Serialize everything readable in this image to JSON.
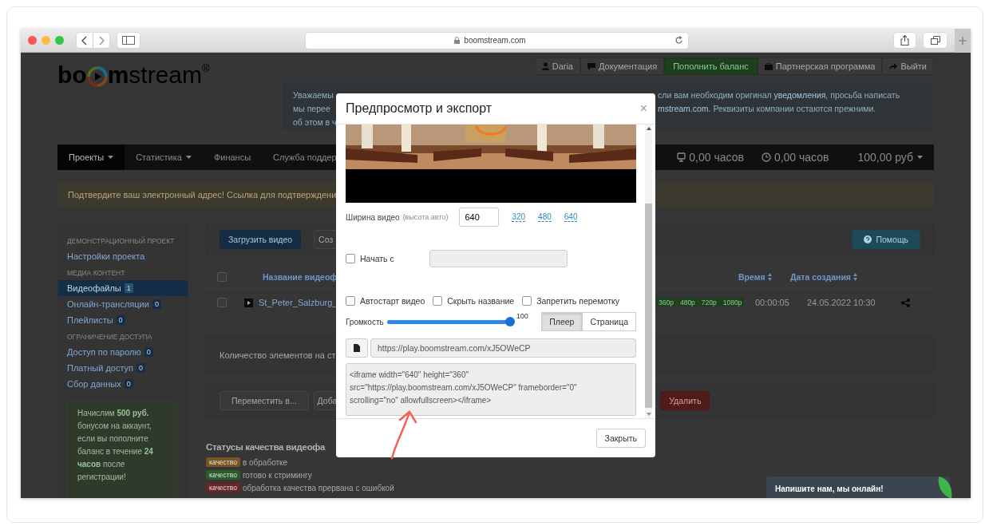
{
  "browser": {
    "address": "boomstream.com"
  },
  "logo": {
    "before": "bo",
    "after": "mstream",
    "mark": "®"
  },
  "top_nav": [
    {
      "label": "Daria",
      "kind": "default"
    },
    {
      "label": "Документация",
      "kind": "default"
    },
    {
      "label": "Пополнить баланс",
      "kind": "success"
    },
    {
      "label": "Партнерская программа",
      "kind": "default"
    },
    {
      "label": "Выйти",
      "kind": "default"
    }
  ],
  "notice": {
    "left_lines": [
      "Уважаемы",
      "мы перее",
      "об этом в ч"
    ],
    "right_lines": [
      "сли вам необходим оригинал **уведомления**, просьба написать",
      "**mstream.com**. Реквизиты компании остаются прежними."
    ]
  },
  "navbar": {
    "items": [
      {
        "label": "Проекты",
        "dropdown": true,
        "selected": true
      },
      {
        "label": "Статистика",
        "dropdown": true,
        "selected": false
      },
      {
        "label": "Финансы",
        "dropdown": false,
        "selected": false
      },
      {
        "label": "Служба поддер",
        "dropdown": false,
        "selected": false
      }
    ],
    "stats": [
      "0,00 часов",
      "0,00 часов"
    ],
    "balance": "100,00 руб"
  },
  "confirm_alert": "Подтвердите ваш электронный адрес! Ссылка для подтверждени",
  "sidebar": {
    "sections": [
      {
        "heading": "ДЕМОНСТРАЦИОННЫЙ ПРОЕКТ",
        "items": [
          {
            "label": "Настройки проекта",
            "selected": false
          }
        ]
      },
      {
        "heading": "МЕДИА КОНТЕНТ",
        "items": [
          {
            "label": "Видеофайлы",
            "count": "1",
            "selected": true
          },
          {
            "label": "Онлайн-трансляции",
            "count": "0",
            "selected": false
          },
          {
            "label": "Плейлисты",
            "count": "0",
            "selected": false
          }
        ]
      },
      {
        "heading": "ОГРАНИЧЕНИЕ ДОСТУПА",
        "items": [
          {
            "label": "Доступ по паролю",
            "count": "0",
            "selected": false
          },
          {
            "label": "Платный доступ",
            "count": "0",
            "selected": false
          },
          {
            "label": "Сбор данных",
            "count": "0",
            "selected": false
          }
        ]
      }
    ],
    "bonus": "Начислим **500 руб.** бонусом на аккаунт, если вы пополните баланс в течение **24 часов** после регистрации!"
  },
  "toolbar": {
    "upload": "Загрузить видео",
    "create": "Соз",
    "help": "Помощь"
  },
  "table": {
    "select_all_checked": false,
    "columns": [
      {
        "label": "Название видеоф"
      },
      {
        "label": "Время",
        "sortable": true
      },
      {
        "label": "Дата создания",
        "sortable": true
      }
    ],
    "rows": [
      {
        "checked": false,
        "name": "St_Peter_Salzburg_",
        "tags": [
          "360p",
          "480p",
          "720p",
          "1080p"
        ],
        "time": "00:00:05",
        "date": "24.05.2022 10:30"
      }
    ]
  },
  "page_size_label": "Количество элементов на ст",
  "bulk": {
    "move": "Переместить в...",
    "add": "Доба",
    "delete": "Удалить"
  },
  "statuses": {
    "title": "Статусы качества видеофа",
    "items": [
      {
        "tag": "качество",
        "color": "#7a5520",
        "text": "в обработке"
      },
      {
        "tag": "качество",
        "color": "#2b5a2b",
        "text": "готово к стримингу"
      },
      {
        "tag": "качество",
        "color": "#6a2624",
        "text": "обработка качества прервана с ошибкой"
      }
    ]
  },
  "chat": {
    "text": "Напишите нам, мы онлайн!"
  },
  "modal": {
    "title": "Предпросмотр и экспорт",
    "close": "×",
    "width": {
      "label": "Ширина видео",
      "hint": "(высота авто)",
      "value": "640",
      "presets": [
        "320",
        "480",
        "640"
      ]
    },
    "start": {
      "label": "Начать с",
      "checked": false,
      "disabled": true
    },
    "options": [
      {
        "label": "Автостарт видео",
        "checked": false
      },
      {
        "label": "Скрыть название",
        "checked": false
      },
      {
        "label": "Запретить перемотку",
        "checked": false
      }
    ],
    "volume": {
      "label": "Громкость",
      "level": 1,
      "reading": "100"
    },
    "modes": [
      {
        "label": "Плеер",
        "selected": true
      },
      {
        "label": "Страница",
        "selected": false
      }
    ],
    "url": "https://play.boomstream.com/xJ5OWeCP",
    "embed": "<iframe width=\"640\" height=\"360\" src=\"https://play.boomstream.com/xJ5OWeCP\" frameborder=\"0\" scrolling=\"no\" allowfullscreen></iframe>",
    "close_button": "Закрыть"
  }
}
